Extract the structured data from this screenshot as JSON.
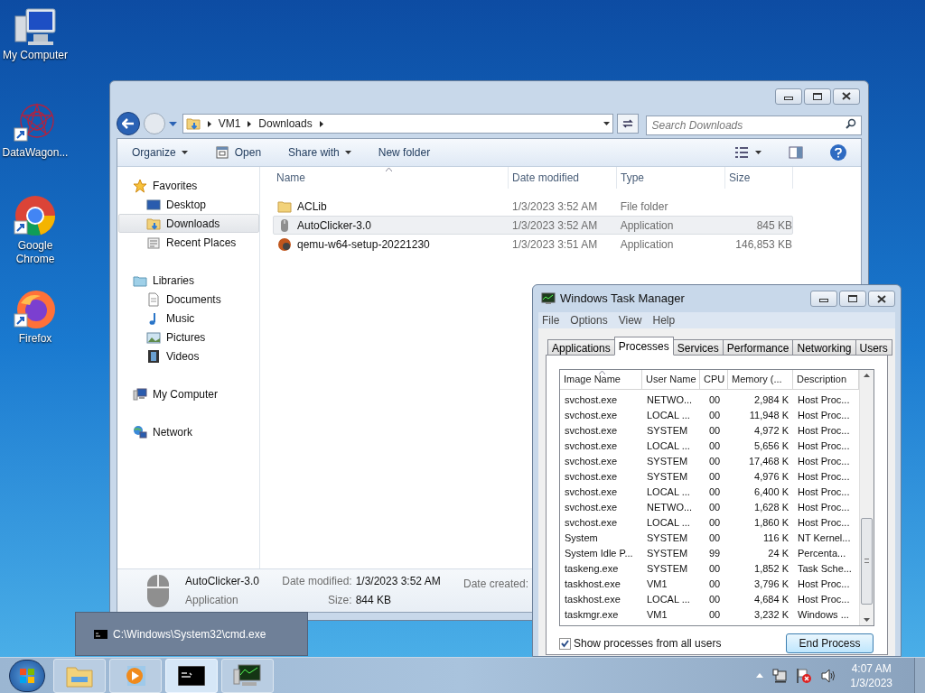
{
  "desktop_icons": [
    {
      "label": "My Computer",
      "kind": "computer"
    },
    {
      "label": "DataWagon...",
      "kind": "datawagon"
    },
    {
      "label": "Google Chrome",
      "kind": "chrome"
    },
    {
      "label": "Firefox",
      "kind": "firefox"
    }
  ],
  "explorer": {
    "breadcrumb": [
      "VM1",
      "Downloads"
    ],
    "search": {
      "placeholder": "Search Downloads"
    },
    "toolbar": [
      {
        "label": "Organize",
        "kind": "menu"
      },
      {
        "label": "Open",
        "kind": "open"
      },
      {
        "label": "Share with",
        "kind": "menu"
      },
      {
        "label": "New folder",
        "kind": "plain"
      }
    ],
    "nav": [
      {
        "label": "Favorites",
        "kind": "star",
        "children": [
          {
            "label": "Desktop",
            "kind": "desktop",
            "selected": false
          },
          {
            "label": "Downloads",
            "kind": "downloads",
            "selected": true
          },
          {
            "label": "Recent Places",
            "kind": "recent",
            "selected": false
          }
        ]
      },
      {
        "label": "Libraries",
        "kind": "libraries",
        "children": [
          {
            "label": "Documents",
            "kind": "documents",
            "selected": false
          },
          {
            "label": "Music",
            "kind": "music",
            "selected": false
          },
          {
            "label": "Pictures",
            "kind": "pictures",
            "selected": false
          },
          {
            "label": "Videos",
            "kind": "videos",
            "selected": false
          }
        ]
      },
      {
        "label": "My Computer",
        "kind": "computer"
      },
      {
        "label": "Network",
        "kind": "network"
      }
    ],
    "columns": [
      "Name",
      "Date modified",
      "Type",
      "Size"
    ],
    "files": [
      {
        "name": "ACLib",
        "date": "1/3/2023 3:52 AM",
        "type": "File folder",
        "kind": "folder",
        "selected": false
      },
      {
        "name": "AutoClicker-3.0",
        "date": "1/3/2023 3:52 AM",
        "type": "Application",
        "size": "845 KB",
        "kind": "mouse",
        "selected": true
      },
      {
        "name": "qemu-w64-setup-20221230",
        "date": "1/3/2023 3:51 AM",
        "type": "Application",
        "size": "146,853 KB",
        "kind": "installer",
        "selected": false
      }
    ],
    "details": {
      "name": "AutoClicker-3.0",
      "type": "Application",
      "fields": [
        {
          "label": "Date modified:",
          "value": "1/3/2023 3:52 AM"
        },
        {
          "label": "Size:",
          "value": "844 KB"
        }
      ],
      "cut_label": "Date created:"
    }
  },
  "task_manager": {
    "title": "Windows Task Manager",
    "menu": [
      "File",
      "Options",
      "View",
      "Help"
    ],
    "tabs": [
      {
        "label": "Applications",
        "selected": false
      },
      {
        "label": "Processes",
        "selected": true
      },
      {
        "label": "Services",
        "selected": false
      },
      {
        "label": "Performance",
        "selected": false
      },
      {
        "label": "Networking",
        "selected": false
      },
      {
        "label": "Users",
        "selected": false
      }
    ],
    "columns": [
      "Image Name",
      "User Name",
      "CPU",
      "Memory (...",
      "Description"
    ],
    "rows": [
      [
        "svchost.exe",
        "NETWO...",
        "00",
        "2,984 K",
        "Host Proc..."
      ],
      [
        "svchost.exe",
        "LOCAL ...",
        "00",
        "11,948 K",
        "Host Proc..."
      ],
      [
        "svchost.exe",
        "SYSTEM",
        "00",
        "4,972 K",
        "Host Proc..."
      ],
      [
        "svchost.exe",
        "LOCAL ...",
        "00",
        "5,656 K",
        "Host Proc..."
      ],
      [
        "svchost.exe",
        "SYSTEM",
        "00",
        "17,468 K",
        "Host Proc..."
      ],
      [
        "svchost.exe",
        "SYSTEM",
        "00",
        "4,976 K",
        "Host Proc..."
      ],
      [
        "svchost.exe",
        "LOCAL ...",
        "00",
        "6,400 K",
        "Host Proc..."
      ],
      [
        "svchost.exe",
        "NETWO...",
        "00",
        "1,628 K",
        "Host Proc..."
      ],
      [
        "svchost.exe",
        "LOCAL ...",
        "00",
        "1,860 K",
        "Host Proc..."
      ],
      [
        "System",
        "SYSTEM",
        "00",
        "116 K",
        "NT Kernel..."
      ],
      [
        "System Idle P...",
        "SYSTEM",
        "99",
        "24 K",
        "Percenta..."
      ],
      [
        "taskeng.exe",
        "SYSTEM",
        "00",
        "1,852 K",
        "Task Sche..."
      ],
      [
        "taskhost.exe",
        "VM1",
        "00",
        "3,796 K",
        "Host Proc..."
      ],
      [
        "taskhost.exe",
        "LOCAL ...",
        "00",
        "4,684 K",
        "Host Proc..."
      ],
      [
        "taskmgr.exe",
        "VM1",
        "00",
        "3,232 K",
        "Windows ..."
      ]
    ],
    "show_all": {
      "label": "Show processes from all users",
      "checked": true
    },
    "end_button": "End Process"
  },
  "taskbar": {
    "preview": {
      "label": "C:\\Windows\\System32\\cmd.exe"
    },
    "buttons": [
      {
        "kind": "explorer",
        "selected": false
      },
      {
        "kind": "media",
        "selected": false
      },
      {
        "kind": "cmd",
        "selected": true
      },
      {
        "kind": "taskmgr",
        "selected": false
      }
    ],
    "clock": {
      "time": "4:07 AM",
      "date": "1/3/2023"
    }
  }
}
